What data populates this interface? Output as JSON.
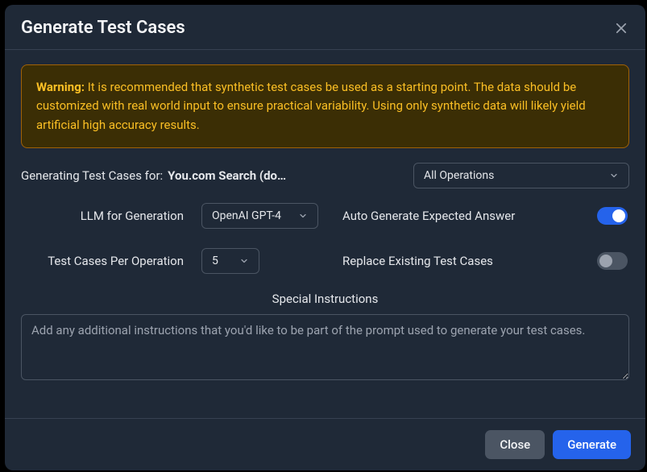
{
  "header": {
    "title": "Generate Test Cases"
  },
  "warning": {
    "label": "Warning:",
    "text": " It is recommended that synthetic test cases be used as a starting point. The data should be customized with real world input to ensure practical variability. Using only synthetic data will likely yield artificial high accuracy results."
  },
  "form": {
    "generating_for_label": "Generating Test Cases for:",
    "generating_for_target": "You.com Search (do…",
    "operations_select": "All Operations",
    "llm_label": "LLM for Generation",
    "llm_select": "OpenAI GPT-4",
    "auto_answer_label": "Auto Generate Expected Answer",
    "auto_answer_on": true,
    "per_op_label": "Test Cases Per Operation",
    "per_op_value": "5",
    "replace_label": "Replace Existing Test Cases",
    "replace_on": false,
    "special_label": "Special Instructions",
    "special_placeholder": "Add any additional instructions that you'd like to be part of the prompt used to generate your test cases."
  },
  "footer": {
    "close": "Close",
    "generate": "Generate"
  }
}
